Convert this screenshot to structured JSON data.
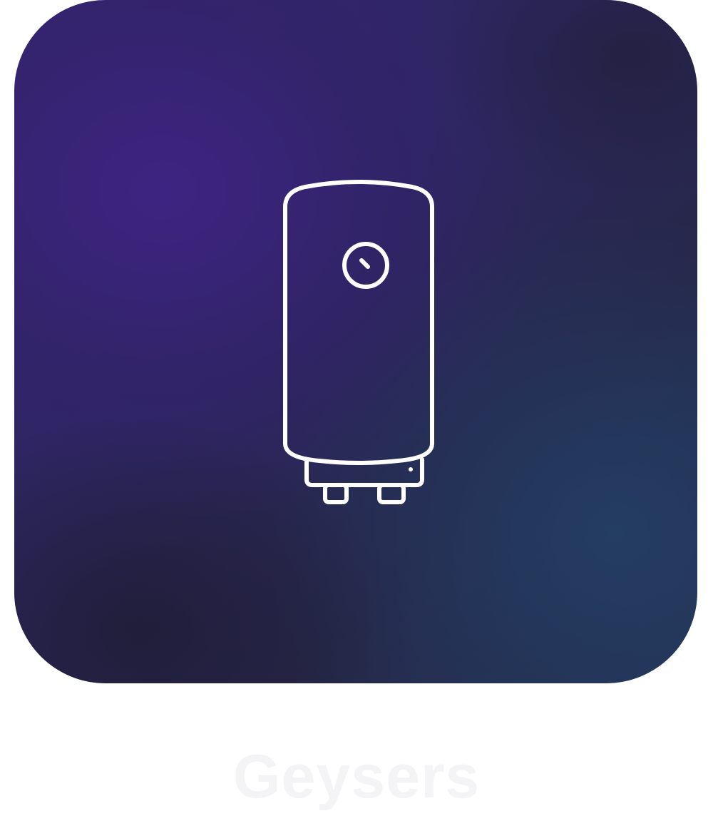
{
  "tile": {
    "icon": "water-heater-icon",
    "label": "Geysers"
  },
  "colors": {
    "tile_primary": "#35246e",
    "tile_secondary": "#24334f",
    "icon_stroke": "#ffffff",
    "label_text": "#f4f4f6"
  }
}
